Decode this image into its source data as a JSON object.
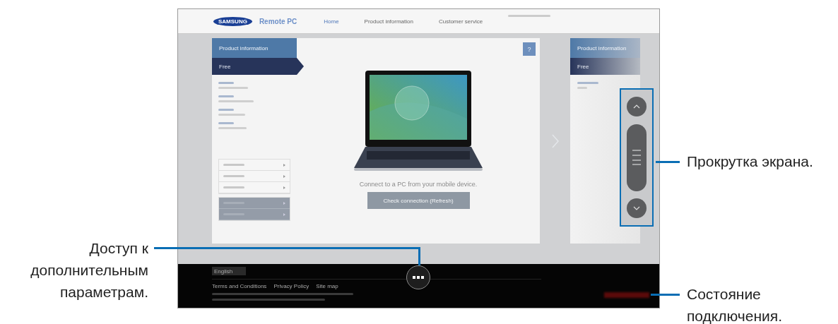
{
  "header": {
    "logo": "SAMSUNG",
    "app_title": "Remote PC",
    "nav": [
      {
        "label": "Home",
        "selected": true
      },
      {
        "label": "Product information",
        "selected": false
      },
      {
        "label": "Customer service",
        "selected": false
      }
    ]
  },
  "sidebar": {
    "title": "Product information",
    "plan": "Free",
    "menu": [
      {
        "disabled": false
      },
      {
        "disabled": false
      },
      {
        "disabled": false
      },
      {
        "disabled": true
      },
      {
        "disabled": true
      }
    ]
  },
  "main": {
    "help": "?",
    "message": "Connect to a PC from your mobile device.",
    "button": "Check connection (Refresh)"
  },
  "peek_card": {
    "title": "Product information",
    "plan": "Free"
  },
  "footer": {
    "language": "English",
    "links": [
      "Terms and Conditions",
      "Privacy Policy",
      "Site map"
    ]
  },
  "callouts": [
    {
      "kind": "scroll",
      "text": "Прокрутка экрана."
    },
    {
      "kind": "more",
      "text": "Доступ к дополнительным параметрам."
    },
    {
      "kind": "status",
      "text": "Состояние подключения."
    }
  ]
}
